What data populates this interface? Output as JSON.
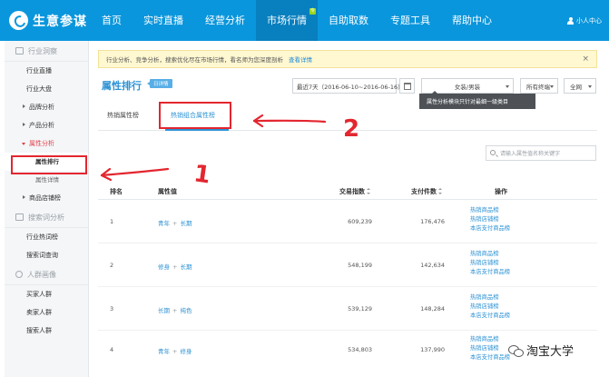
{
  "topnav": {
    "logo_text": "生意参谋",
    "items": [
      {
        "label": "首页"
      },
      {
        "label": "实时直播"
      },
      {
        "label": "经营分析"
      },
      {
        "label": "市场行情",
        "badge": "专"
      },
      {
        "label": "自助取数"
      },
      {
        "label": "专题工具"
      },
      {
        "label": "帮助中心"
      }
    ],
    "user_label": "小人中心"
  },
  "sidebar": {
    "sections": [
      {
        "title": "行业洞察",
        "icon": "monitor-icon"
      },
      {
        "title": "搜索词分析",
        "icon": "search-icon"
      },
      {
        "title": "人群画像",
        "icon": "people-icon"
      }
    ],
    "items": [
      "行业直播",
      "行业大盘",
      "品牌分析",
      "产品分析",
      "属性分析",
      "属性排行",
      "属性详情",
      "商品店铺榜",
      "行业热词榜",
      "搜索词查询",
      "买家人群",
      "卖家人群",
      "搜索人群"
    ]
  },
  "notice": {
    "text": "行业分析、竞争分析，搜索优化尽在市场行情，看名师为您深度剖析",
    "link": "查看详情",
    "close": "×"
  },
  "page": {
    "title": "属性排行",
    "tag": "日详情",
    "date_range": "最近7天（2016-06-10~2016-06-16）",
    "industry": "女装/男装",
    "terminal": "所有终端",
    "network": "全网",
    "tooltip": "属性分析模块只针对最细一级类目"
  },
  "tabs": {
    "hot": "热销属性榜",
    "combo": "热销组合属性榜"
  },
  "search": {
    "placeholder": "请输入属性值名称关键字"
  },
  "table": {
    "headers": {
      "rank": "排名",
      "attr": "属性值",
      "trade": "交易指数",
      "pay": "支付件数",
      "ops": "操作"
    },
    "rows": [
      {
        "rank": "1",
        "a1": "青年",
        "a2": "长期",
        "trade": "609,239",
        "pay": "176,476"
      },
      {
        "rank": "2",
        "a1": "修身",
        "a2": "长期",
        "trade": "548,199",
        "pay": "142,634"
      },
      {
        "rank": "3",
        "a1": "长期",
        "a2": "纯色",
        "trade": "539,129",
        "pay": "148,284"
      },
      {
        "rank": "4",
        "a1": "青年",
        "a2": "修身",
        "trade": "534,803",
        "pay": "137,990"
      }
    ],
    "ops": [
      "热销商品榜",
      "热销店铺榜",
      "本店支付商品榜"
    ]
  },
  "annotations": {
    "num1": "1",
    "num2": "2",
    "color": "#e3262f"
  },
  "watermark": {
    "text": "淘宝大学"
  }
}
